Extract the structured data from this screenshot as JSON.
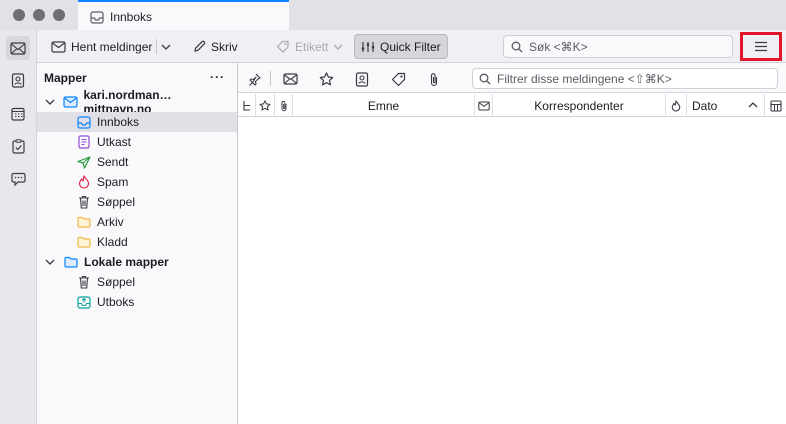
{
  "window": {
    "tab_title": "Innboks"
  },
  "spaces": [
    {
      "name": "mail-icon",
      "active": true
    },
    {
      "name": "address-book-icon",
      "active": false
    },
    {
      "name": "calendar-icon",
      "active": false
    },
    {
      "name": "tasks-icon",
      "active": false
    },
    {
      "name": "chat-icon",
      "active": false
    }
  ],
  "toolbar": {
    "get_messages_label": "Hent meldinger",
    "write_label": "Skriv",
    "tag_label": "Etikett",
    "quick_filter_label": "Quick Filter",
    "search_placeholder": "Søk <⌘K>"
  },
  "folder_pane": {
    "header_label": "Mapper",
    "more_label": "···",
    "accounts": [
      {
        "name": "kari.nordman…mittnavn.no",
        "folders": [
          {
            "label": "Innboks",
            "icon": "inbox-icon",
            "selected": true
          },
          {
            "label": "Utkast",
            "icon": "drafts-icon",
            "selected": false
          },
          {
            "label": "Sendt",
            "icon": "sent-icon",
            "selected": false
          },
          {
            "label": "Spam",
            "icon": "spam-icon",
            "selected": false
          },
          {
            "label": "Søppel",
            "icon": "trash-icon",
            "selected": false
          },
          {
            "label": "Arkiv",
            "icon": "archive-folder-icon",
            "selected": false
          },
          {
            "label": "Kladd",
            "icon": "folder-icon",
            "selected": false
          }
        ]
      },
      {
        "name": "Lokale mapper",
        "folders": [
          {
            "label": "Søppel",
            "icon": "trash-icon",
            "selected": false
          },
          {
            "label": "Utboks",
            "icon": "outbox-icon",
            "selected": false
          }
        ]
      }
    ]
  },
  "thread_pane": {
    "filter_placeholder": "Filtrer disse meldingene <⇧⌘K>",
    "columns": {
      "subject": "Emne",
      "correspondents": "Korrespondenter",
      "date": "Dato"
    }
  },
  "colors": {
    "accent": "#0a84ff",
    "highlight_box": "#e0162b",
    "drafts": "#8c4fd6",
    "sent": "#2a9d3e",
    "spam": "#e22850",
    "folder": "#f2b94a",
    "inbox": "#0a84ff"
  }
}
